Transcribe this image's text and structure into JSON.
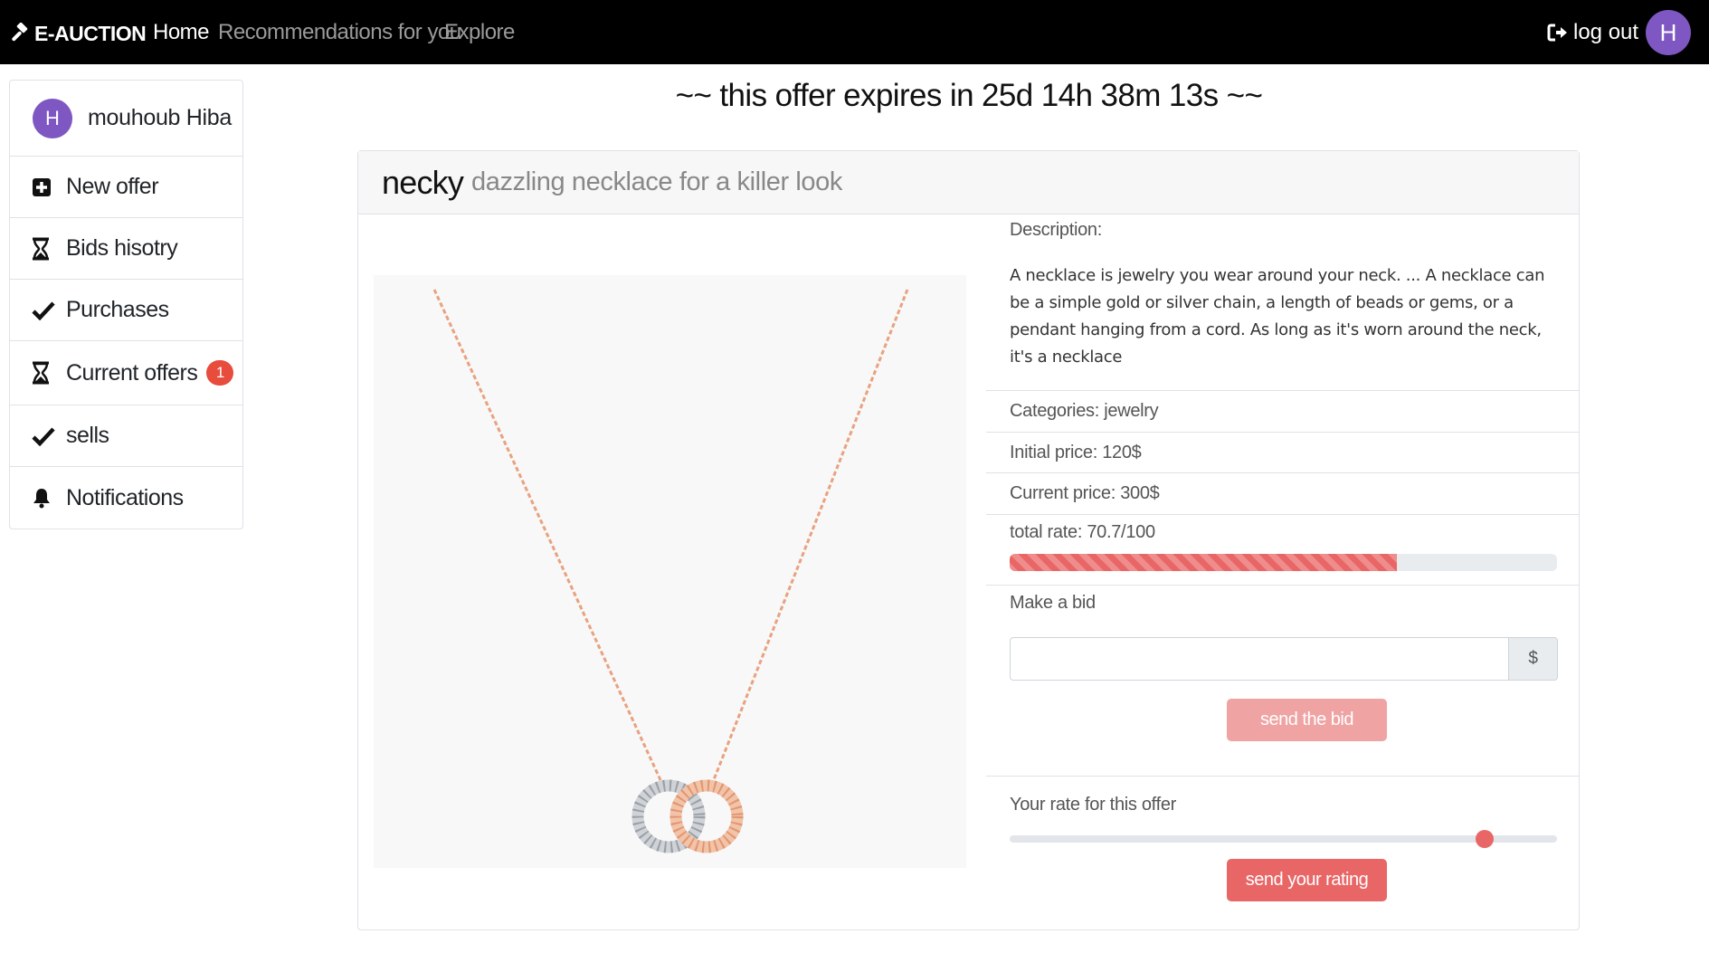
{
  "nav": {
    "brand": "E-AUCTION",
    "links": [
      "Home",
      "Recommendations for you",
      "Explore"
    ],
    "logout": "log out",
    "avatar_letter": "H"
  },
  "sidebar": {
    "user_name": "mouhoub Hiba",
    "avatar_letter": "H",
    "items": [
      {
        "label": "New offer",
        "icon": "plus-square-icon"
      },
      {
        "label": "Bids hisotry",
        "icon": "hourglass-icon"
      },
      {
        "label": "Purchases",
        "icon": "check-icon"
      },
      {
        "label": "Current offers",
        "icon": "hourglass-icon",
        "badge": "1"
      },
      {
        "label": "sells",
        "icon": "check-icon"
      },
      {
        "label": "Notifications",
        "icon": "bell-icon"
      }
    ]
  },
  "expiry_text": "~~ this offer expires in 25d 14h 38m 13s ~~",
  "offer": {
    "name": "necky",
    "subtitle": "dazzling necklace for a killer look",
    "description_label": "Description:",
    "description": "A necklace is jewelry you wear around your neck. ... A necklace can be a simple gold or silver chain, a length of beads or gems, or a pendant hanging from a cord. As long as it's worn around the neck, it's a necklace",
    "categories": "Categories: jewelry",
    "initial_price": "Initial price: 120$",
    "current_price": "Current price: 300$",
    "total_rate": "total rate: 70.7/100",
    "rate_fraction": 0.707
  },
  "bid": {
    "label": "Make a bid",
    "value": "",
    "currency": "$",
    "button": "send the bid"
  },
  "rating": {
    "label": "Your rate for this offer",
    "slider_fraction": 0.867,
    "button": "send your rating"
  },
  "colors": {
    "accent": "#e96666",
    "avatar": "#7e57c2",
    "navbar": "#000000"
  }
}
